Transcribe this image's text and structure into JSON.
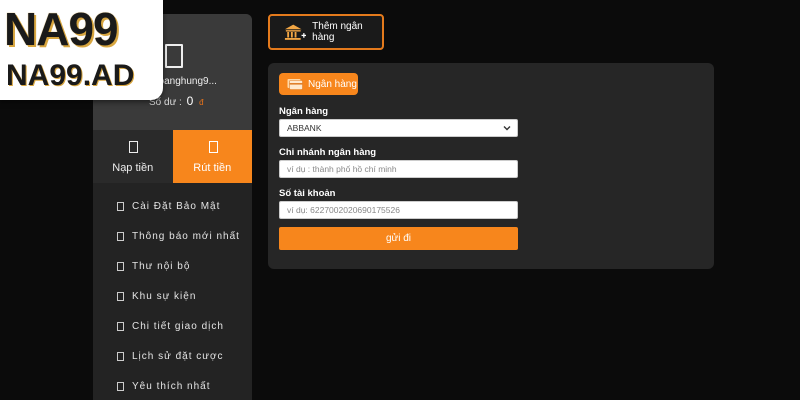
{
  "logo": {
    "brand": "NA99",
    "domain": "NA99.AD"
  },
  "profile": {
    "username": "hoanghung9...",
    "balance_label": "Số dư :",
    "balance_value": "0",
    "currency_icon": "dong-icon"
  },
  "tabs": [
    {
      "label": "Nạp tiền",
      "icon": "deposit-icon",
      "active": false
    },
    {
      "label": "Rút tiền",
      "icon": "withdraw-icon",
      "active": true
    }
  ],
  "menu": [
    {
      "label": "Cài Đặt Bảo Mật"
    },
    {
      "label": "Thông báo mới nhất"
    },
    {
      "label": "Thư nội bộ"
    },
    {
      "label": "Khu sự kiện"
    },
    {
      "label": "Chi tiết giao dịch"
    },
    {
      "label": "Lịch sử đặt cược"
    },
    {
      "label": "Yêu thích nhất"
    }
  ],
  "add_bank": {
    "label": "Thêm ngân hàng",
    "icon": "bank-plus-icon"
  },
  "form": {
    "tab_label": "Ngân hàng",
    "tab_icon": "card-icon",
    "bank_label": "Ngân hàng",
    "bank_value": "ABBANK",
    "branch_label": "Chi nhánh ngân hàng",
    "branch_placeholder": "ví dụ : thành phố hồ chí minh",
    "account_label": "Số tài khoản",
    "account_placeholder": "ví dụ: 6227002020690175526",
    "submit_label": "gửi đi"
  },
  "colors": {
    "accent": "#f7861c",
    "panel": "#262626",
    "background": "#0b0b0b"
  }
}
